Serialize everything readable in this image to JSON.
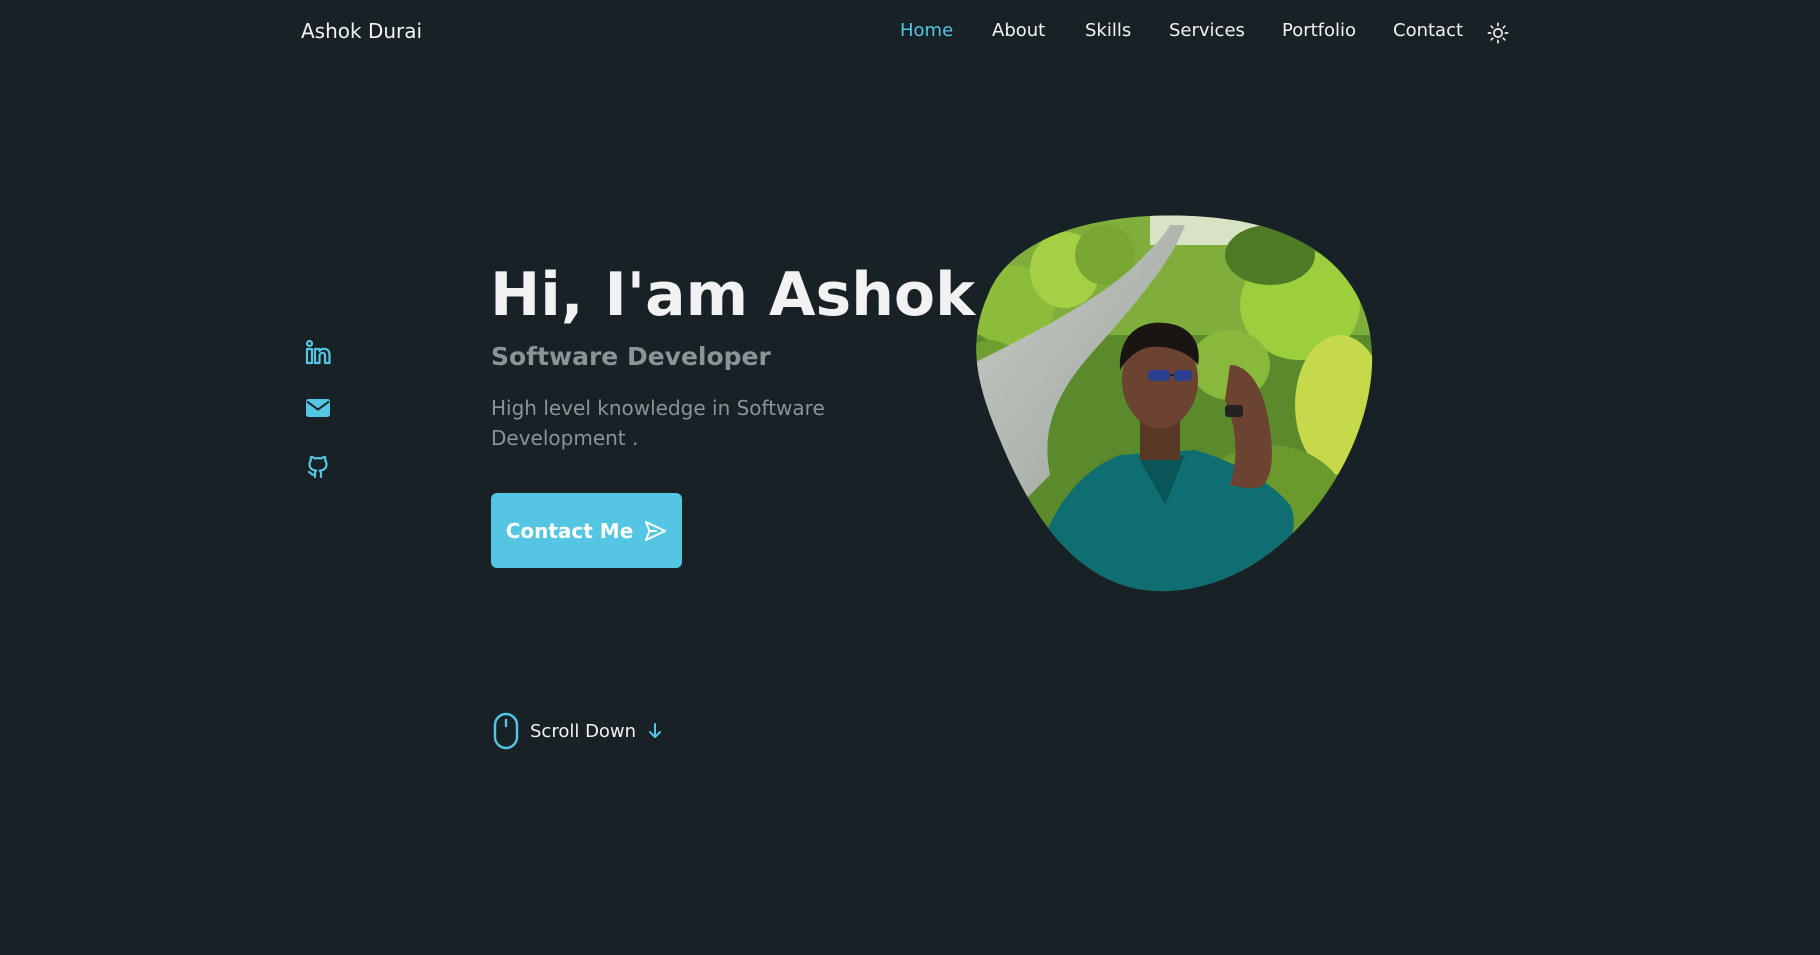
{
  "header": {
    "logo": "Ashok Durai",
    "nav": [
      {
        "label": "Home",
        "active": true
      },
      {
        "label": "About",
        "active": false
      },
      {
        "label": "Skills",
        "active": false
      },
      {
        "label": "Services",
        "active": false
      },
      {
        "label": "Portfolio",
        "active": false
      },
      {
        "label": "Contact",
        "active": false
      }
    ],
    "theme_toggle_icon": "sun-icon"
  },
  "social": [
    {
      "icon": "linkedin-icon"
    },
    {
      "icon": "email-icon"
    },
    {
      "icon": "github-icon"
    }
  ],
  "hero": {
    "title": "Hi, I'am Ashok",
    "subtitle": "Software Developer",
    "description": "High level knowledge in Software Development .",
    "button_label": "Contact Me",
    "button_icon": "send-icon"
  },
  "scroll": {
    "label": "Scroll Down",
    "icon": "mouse-icon",
    "arrow_icon": "arrow-down-icon"
  },
  "profile_image": {
    "subject": "profile photo",
    "shape": "blob"
  },
  "colors": {
    "background": "#182226",
    "accent": "#54c6e4",
    "text": "#f2f2f2",
    "muted": "#8a9396"
  }
}
